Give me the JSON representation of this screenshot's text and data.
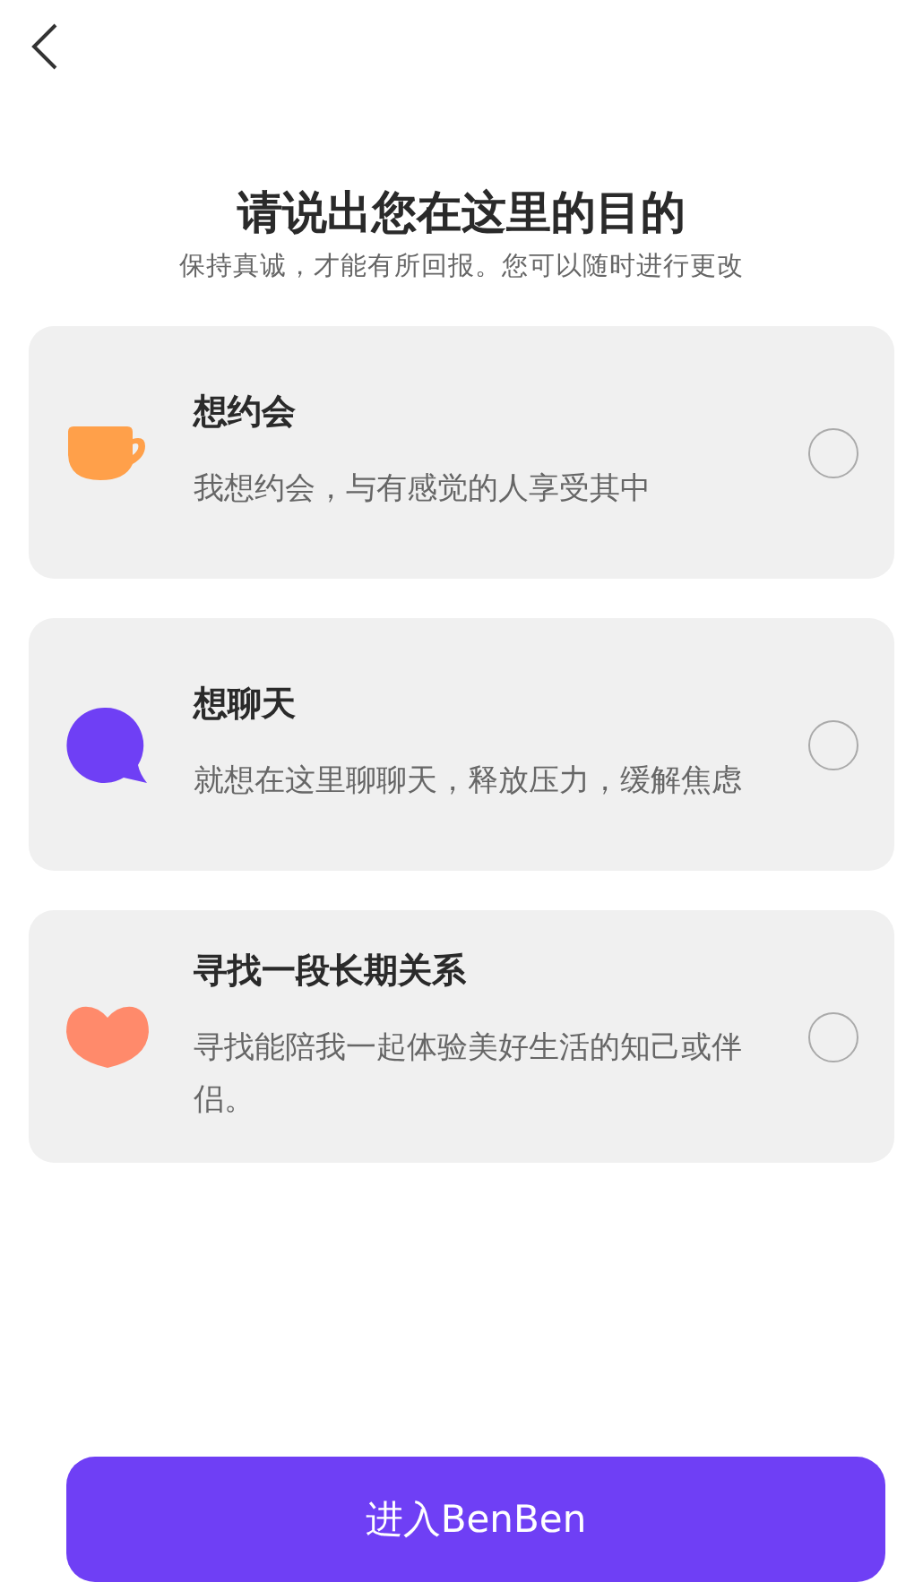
{
  "header": {
    "title": "请说出您在这里的目的",
    "subtitle": "保持真诚，才能有所回报。您可以随时进行更改"
  },
  "options": [
    {
      "kind": "cup",
      "color": "#ffa04a",
      "title": "想约会",
      "description": "我想约会，与有感觉的人享受其中",
      "selected": false
    },
    {
      "kind": "chat",
      "color": "#6f3ff5",
      "title": "想聊天",
      "description": "就想在这里聊聊天，释放压力，缓解焦虑",
      "selected": false
    },
    {
      "kind": "heart",
      "color": "#ff8a6b",
      "title": "寻找一段长期关系",
      "description": "寻找能陪我一起体验美好生活的知己或伴侣。",
      "selected": false
    }
  ],
  "button": {
    "label": "进入BenBen"
  }
}
